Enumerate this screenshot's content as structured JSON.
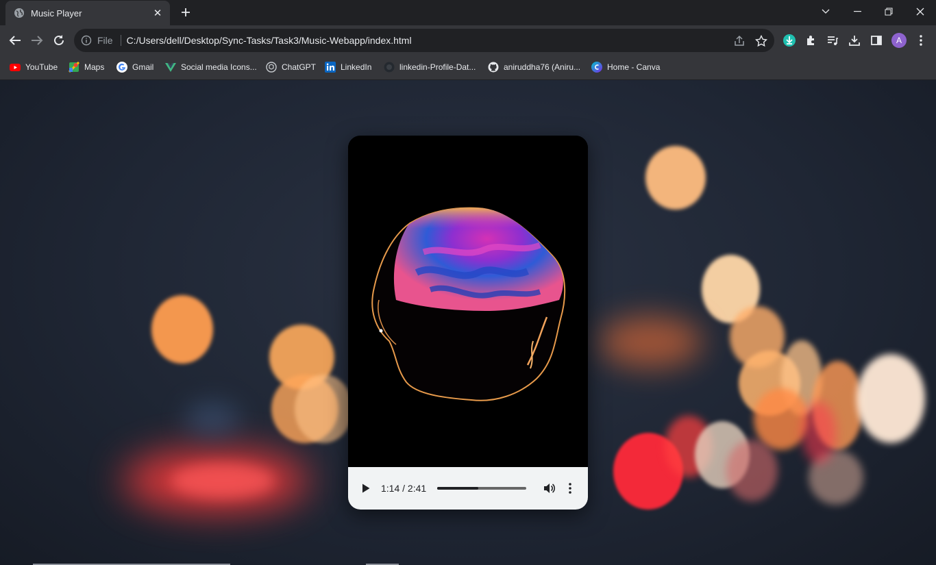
{
  "browser": {
    "tab": {
      "title": "Music Player",
      "favicon": "globe-icon"
    },
    "address_bar": {
      "scheme_label": "File",
      "url": "C:/Users/dell/Desktop/Sync-Tasks/Task3/Music-Webapp/index.html"
    },
    "profile_initial": "A",
    "bookmarks": [
      {
        "label": "YouTube",
        "icon": "youtube-icon"
      },
      {
        "label": "Maps",
        "icon": "maps-icon"
      },
      {
        "label": "Gmail",
        "icon": "google-icon"
      },
      {
        "label": "Social media Icons...",
        "icon": "vue-icon"
      },
      {
        "label": "ChatGPT",
        "icon": "chatgpt-icon"
      },
      {
        "label": "LinkedIn",
        "icon": "linkedin-icon"
      },
      {
        "label": "linkedin-Profile-Dat...",
        "icon": "github-dark-icon"
      },
      {
        "label": "aniruddha76 (Aniru...",
        "icon": "github-icon"
      },
      {
        "label": "Home - Canva",
        "icon": "canva-icon"
      }
    ]
  },
  "player": {
    "current_time": "1:14",
    "duration": "2:41",
    "time_display": "1:14 / 2:41",
    "progress_fraction": 0.46,
    "artwork": "abstract-bubble-artwork"
  }
}
